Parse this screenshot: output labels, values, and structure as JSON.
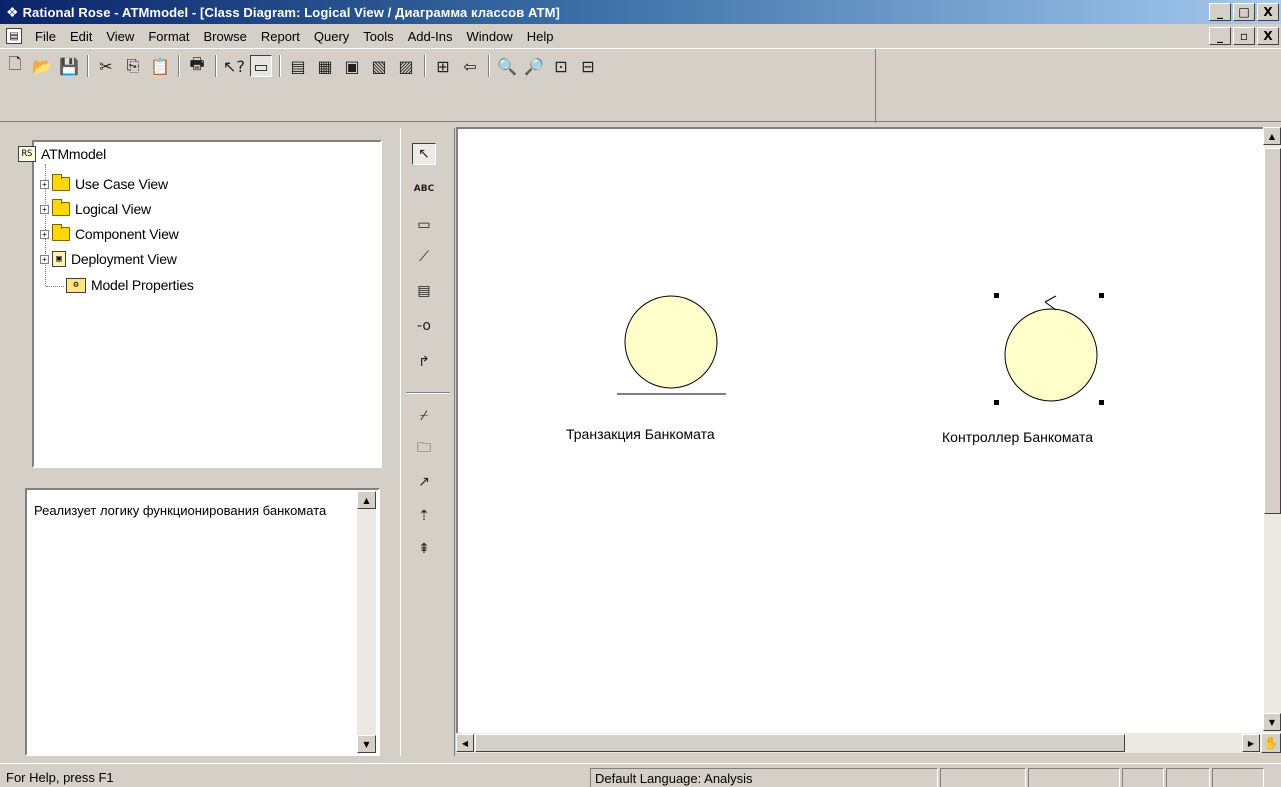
{
  "window": {
    "title": "Rational Rose - ATMmodel - [Class Diagram: Logical View / Диаграмма классов ATM]",
    "app_icon": "rose-icon",
    "buttons": [
      "_",
      "□",
      "X"
    ],
    "mdi_buttons": [
      "_",
      "▫",
      "X"
    ]
  },
  "menubar": {
    "items": [
      "File",
      "Edit",
      "View",
      "Format",
      "Browse",
      "Report",
      "Query",
      "Tools",
      "Add-Ins",
      "Window",
      "Help"
    ]
  },
  "toolbar": {
    "buttons": [
      {
        "name": "new-icon",
        "glyph": "🗋"
      },
      {
        "name": "open-icon",
        "glyph": "📂"
      },
      {
        "name": "save-icon",
        "glyph": "💾"
      },
      {
        "name": "sep"
      },
      {
        "name": "cut-icon",
        "glyph": "✂"
      },
      {
        "name": "copy-icon",
        "glyph": "⎘"
      },
      {
        "name": "paste-icon",
        "glyph": "📋"
      },
      {
        "name": "sep"
      },
      {
        "name": "print-icon",
        "glyph": "🖶"
      },
      {
        "name": "sep"
      },
      {
        "name": "context-help-icon",
        "glyph": "↖?"
      },
      {
        "name": "view-doc-icon",
        "glyph": "▭",
        "pressed": true
      },
      {
        "name": "sep"
      },
      {
        "name": "browse-class-diagram-icon",
        "glyph": "▤"
      },
      {
        "name": "browse-interaction-diagram-icon",
        "glyph": "▦"
      },
      {
        "name": "browse-component-diagram-icon",
        "glyph": "▣"
      },
      {
        "name": "browse-statechart-icon",
        "glyph": "▧"
      },
      {
        "name": "browse-deployment-icon",
        "glyph": "▨"
      },
      {
        "name": "sep"
      },
      {
        "name": "browse-parent-icon",
        "glyph": "⊞"
      },
      {
        "name": "browse-previous-icon",
        "glyph": "⇦"
      },
      {
        "name": "sep"
      },
      {
        "name": "zoom-in-icon",
        "glyph": "🔍"
      },
      {
        "name": "zoom-out-icon",
        "glyph": "🔎"
      },
      {
        "name": "fit-in-window-icon",
        "glyph": "⊡"
      },
      {
        "name": "undo-fit-icon",
        "glyph": "⊟"
      }
    ]
  },
  "browser": {
    "root": {
      "label": "ATMmodel",
      "icon": "model-icon"
    },
    "items": [
      {
        "label": "Use Case View",
        "icon": "folder-icon",
        "expander": "+"
      },
      {
        "label": "Logical View",
        "icon": "folder-icon",
        "expander": "+"
      },
      {
        "label": "Component View",
        "icon": "folder-icon",
        "expander": "+"
      },
      {
        "label": "Deployment View",
        "icon": "deployment-icon",
        "expander": "+"
      },
      {
        "label": "Model Properties",
        "icon": "properties-icon",
        "expander": ""
      }
    ]
  },
  "documentation": {
    "text": "Реализует логику функционирования банкомата"
  },
  "toolbox": {
    "tools": [
      {
        "name": "selection-tool",
        "glyph": "↖",
        "selected": true
      },
      {
        "name": "text-box-tool",
        "glyph": "ABC"
      },
      {
        "name": "note-tool",
        "glyph": "▭"
      },
      {
        "name": "anchor-note-tool",
        "glyph": "⟋"
      },
      {
        "name": "class-tool",
        "glyph": "▤"
      },
      {
        "name": "interface-tool",
        "glyph": "-o"
      },
      {
        "name": "unidirectional-association-tool",
        "glyph": "↱"
      },
      {
        "name": "association-class-tool",
        "glyph": "⌿"
      },
      {
        "name": "package-tool",
        "glyph": "🗀"
      },
      {
        "name": "dependency-tool",
        "glyph": "↗"
      },
      {
        "name": "generalization-tool",
        "glyph": "⇡"
      },
      {
        "name": "realization-tool",
        "glyph": "⇞"
      }
    ]
  },
  "diagram": {
    "elements": [
      {
        "name": "entity-class-transaction",
        "label": "Транзакция Банкомата",
        "stereotype": "entity"
      },
      {
        "name": "control-class-controller",
        "label": "Контроллер Банкомата",
        "stereotype": "control",
        "selected": true
      }
    ],
    "fill_color": "#ffffcc"
  },
  "statusbar": {
    "help": "For Help, press F1",
    "language": "Default Language: Analysis"
  }
}
